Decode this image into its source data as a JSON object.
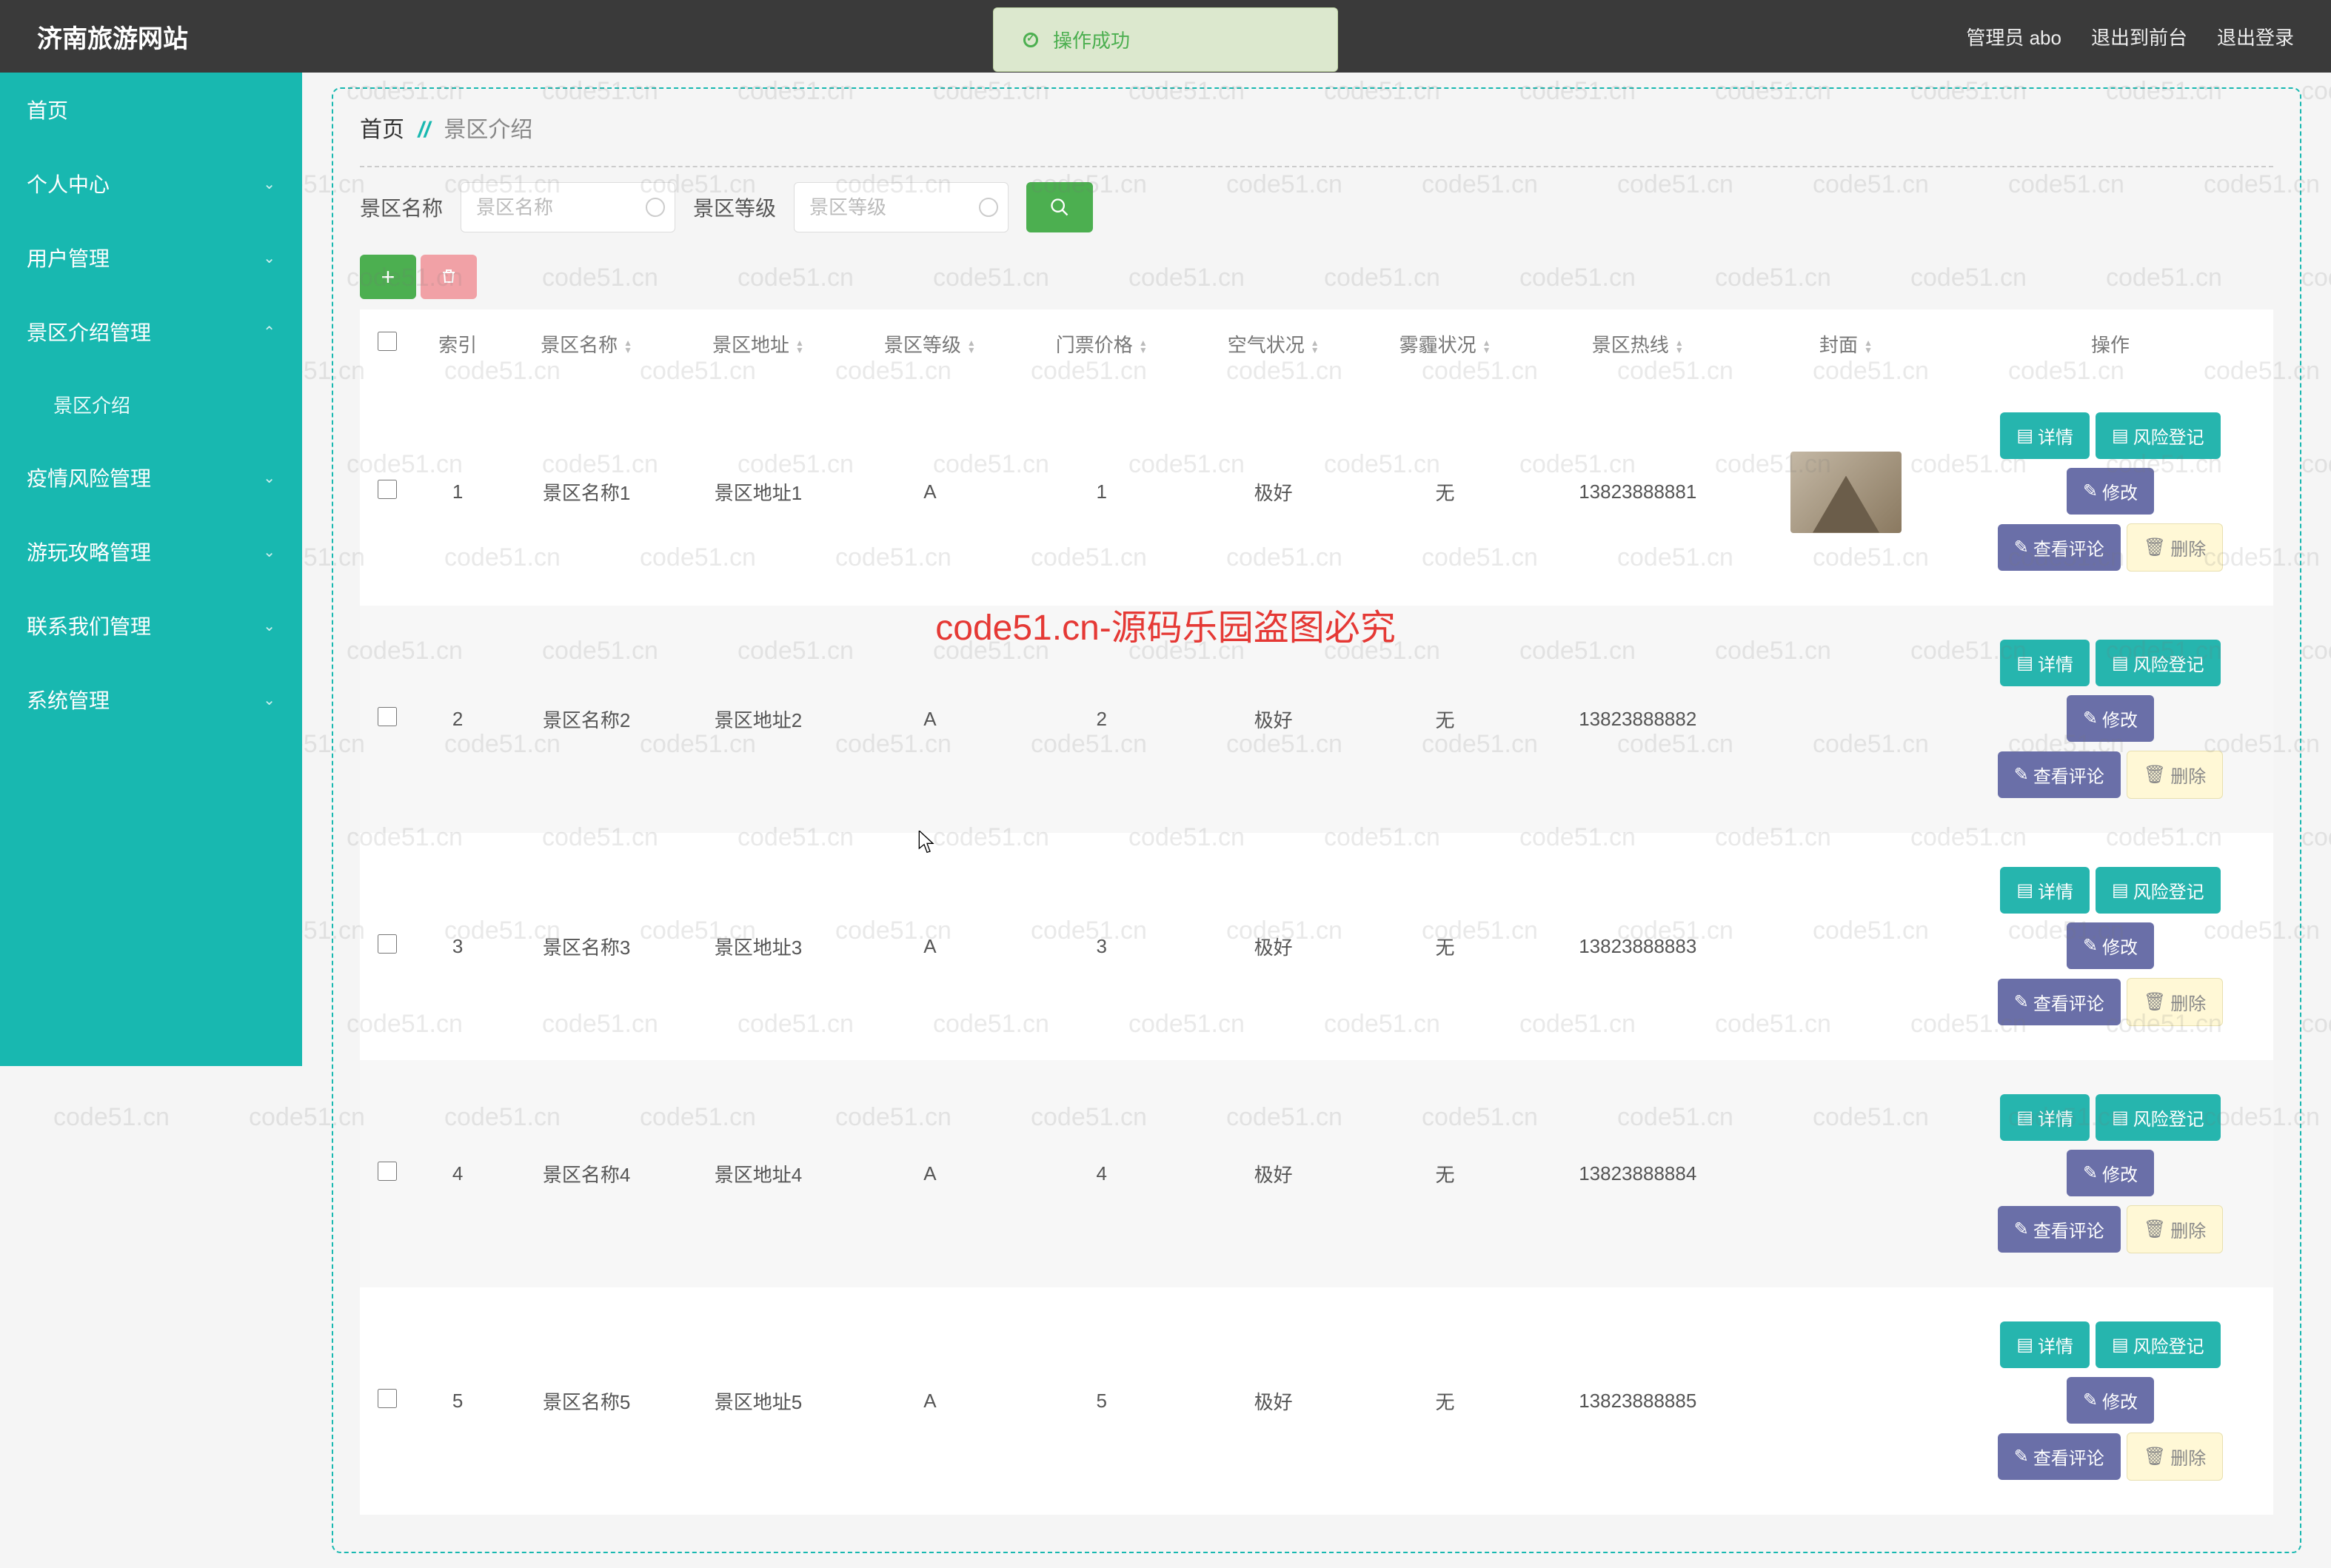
{
  "header": {
    "logo": "济南旅游网站",
    "admin_label": "管理员 abo",
    "back_front": "退出到前台",
    "logout": "退出登录"
  },
  "toast": {
    "message": "操作成功"
  },
  "sidebar": {
    "items": [
      {
        "label": "首页",
        "expandable": false
      },
      {
        "label": "个人中心",
        "expandable": true,
        "chev": "⌄"
      },
      {
        "label": "用户管理",
        "expandable": true,
        "chev": "⌄"
      },
      {
        "label": "景区介绍管理",
        "expandable": true,
        "chev": "⌃"
      },
      {
        "label": "景区介绍",
        "sub": true
      },
      {
        "label": "疫情风险管理",
        "expandable": true,
        "chev": "⌄"
      },
      {
        "label": "游玩攻略管理",
        "expandable": true,
        "chev": "⌄"
      },
      {
        "label": "联系我们管理",
        "expandable": true,
        "chev": "⌄"
      },
      {
        "label": "系统管理",
        "expandable": true,
        "chev": "⌄"
      }
    ]
  },
  "breadcrumb": {
    "root": "首页",
    "sep": "//",
    "current": "景区介绍"
  },
  "filters": {
    "name_label": "景区名称",
    "name_placeholder": "景区名称",
    "level_label": "景区等级",
    "level_placeholder": "景区等级"
  },
  "columns": {
    "index": "索引",
    "name": "景区名称",
    "address": "景区地址",
    "level": "景区等级",
    "price": "门票价格",
    "air": "空气状况",
    "fog": "雾霾状况",
    "hotline": "景区热线",
    "cover": "封面",
    "ops": "操作"
  },
  "rows": [
    {
      "index": "1",
      "name": "景区名称1",
      "address": "景区地址1",
      "level": "A",
      "price": "1",
      "air": "极好",
      "fog": "无",
      "hotline": "13823888881",
      "has_img": true
    },
    {
      "index": "2",
      "name": "景区名称2",
      "address": "景区地址2",
      "level": "A",
      "price": "2",
      "air": "极好",
      "fog": "无",
      "hotline": "13823888882",
      "has_img": false
    },
    {
      "index": "3",
      "name": "景区名称3",
      "address": "景区地址3",
      "level": "A",
      "price": "3",
      "air": "极好",
      "fog": "无",
      "hotline": "13823888883",
      "has_img": false
    },
    {
      "index": "4",
      "name": "景区名称4",
      "address": "景区地址4",
      "level": "A",
      "price": "4",
      "air": "极好",
      "fog": "无",
      "hotline": "13823888884",
      "has_img": false
    },
    {
      "index": "5",
      "name": "景区名称5",
      "address": "景区地址5",
      "level": "A",
      "price": "5",
      "air": "极好",
      "fog": "无",
      "hotline": "13823888885",
      "has_img": false
    }
  ],
  "ops": {
    "detail": "详情",
    "risk": "风险登记",
    "edit": "修改",
    "comments": "查看评论",
    "delete": "删除"
  },
  "watermark": {
    "text": "code51.cn",
    "center": "code51.cn-源码乐园盗图必究"
  }
}
